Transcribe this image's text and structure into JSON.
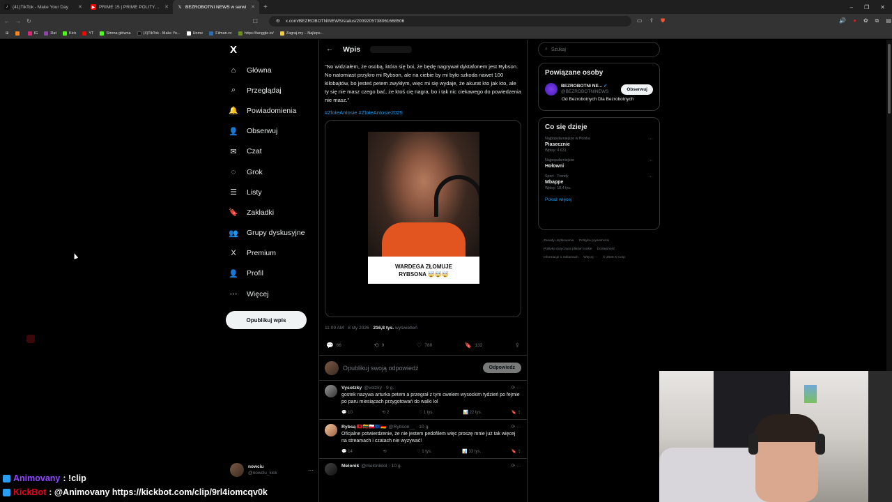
{
  "browser": {
    "tabs": [
      {
        "title": "(41)TikTok - Make Your Day",
        "icon_color": "#111111",
        "icon": "tiktok-icon",
        "active": false
      },
      {
        "title": "PRIME 15 | PRIME POLITYK SHOW -",
        "icon_color": "#ff0000",
        "icon": "youtube-icon",
        "active": false
      },
      {
        "title": "BEZROBOTNI NEWS w serwi",
        "icon_color": "#ffffff",
        "icon": "x-icon",
        "active": true
      }
    ],
    "new_tab": "+",
    "url": "x.com/BEZROBOTNINEWS/status/2009205738061668506",
    "bookmarks": [
      {
        "label": "",
        "color": "#f58220"
      },
      {
        "label": "IG",
        "color": "#d62976"
      },
      {
        "label": "Rat",
        "color": "#8e44ad"
      },
      {
        "label": "Kick",
        "color": "#53fc18"
      },
      {
        "label": "YT",
        "color": "#ff0000"
      },
      {
        "label": "Strona główna",
        "color": "#53fc18"
      },
      {
        "label": "(4)TikTok - Make Yo...",
        "color": "#111111"
      },
      {
        "label": "Home",
        "color": "#ffffff"
      },
      {
        "label": "Filman.cc",
        "color": "#2b6cb0"
      },
      {
        "label": "https://tanggle.io/",
        "color": "#6b8e23"
      },
      {
        "label": "Zagraj.my – Najleps...",
        "color": "#f2c94c"
      }
    ]
  },
  "nav": {
    "logo": "X",
    "items": [
      {
        "label": "Główna",
        "icon": "⌂",
        "name": "home"
      },
      {
        "label": "Przeglądaj",
        "icon": "⌕",
        "name": "explore"
      },
      {
        "label": "Powiadomienia",
        "icon": "🔔",
        "name": "notifications"
      },
      {
        "label": "Obserwuj",
        "icon": "👤",
        "name": "follow"
      },
      {
        "label": "Czat",
        "icon": "✉",
        "name": "chat"
      },
      {
        "label": "Grok",
        "icon": "◌",
        "name": "grok"
      },
      {
        "label": "Listy",
        "icon": "☰",
        "name": "lists"
      },
      {
        "label": "Zakładki",
        "icon": "🔖",
        "name": "bookmarks"
      },
      {
        "label": "Grupy dyskusyjne",
        "icon": "👥",
        "name": "communities"
      },
      {
        "label": "Premium",
        "icon": "X",
        "name": "premium"
      },
      {
        "label": "Profil",
        "icon": "👤",
        "name": "profile"
      },
      {
        "label": "Więcej",
        "icon": "⋯",
        "name": "more"
      }
    ],
    "post_button": "Opublikuj wpis",
    "account": {
      "name": "nowciu",
      "handle": "@nowclu_kick",
      "dots": "···"
    }
  },
  "post": {
    "header": "Wpis",
    "text": "\"No widziałem, że osobą, która się boi, że będę nagrywał dyktafonem jest Rybson. No natomiast przykro mi Rybson, ale na ciebie by mi było szkoda nawet 100 kilobajtów, bo jesteś petem zwykłym, więc mi się wydaje, że akurat kto jak kto, ale ty się nie masz czego bać, że ktoś cię nagra, bo i tak nic ciekawego do powiedzenia nie masz.\"",
    "hashtags": "#ZloteAntosie #ZloteAntosie2025",
    "media_caption_1": "WARDEGA ZŁOMUJE",
    "media_caption_2": "RYBSONA 🤯🤯🤯",
    "time": "11:09 AM · 8 sty 2026 · ",
    "views_num": "216,8 tys.",
    "views_label": " wyświetleń",
    "stats": {
      "replies": "66",
      "reposts": "9",
      "likes": "780",
      "bookmarks": "132"
    },
    "reply_placeholder": "Opublikuj swoją odpowiedź",
    "reply_button": "Odpowiedz"
  },
  "replies": [
    {
      "name": "Vysotzky",
      "handle": "@vstzky · 9 g.",
      "text": "gostek nazywa arturka petem a przegrał z tym cwelem wysockim tydzień po fejmie po paru miesiącach przygotowań do walki lol",
      "stats": {
        "replies": "10",
        "reposts": "2",
        "likes": "1 tys.",
        "views": "22 tys."
      }
    },
    {
      "name": "Rybsą 🇦🇱🇱🇹🇵🇱🇪🇺🇩🇪",
      "handle": "@Rybson__ · 10 g.",
      "text": "Oficjalne potwierdzenie, że nie jestem pedofilem więc proszę mnie już tak więcej na streamach i czatach nie wyzywać!",
      "stats": {
        "replies": "14",
        "reposts": "",
        "likes": "1 tys.",
        "views": "33 tys."
      }
    },
    {
      "name": "Melonik",
      "handle": "@meloniklol · 10 g.",
      "text": "",
      "stats": {
        "replies": "",
        "reposts": "",
        "likes": "",
        "views": ""
      }
    }
  ],
  "sidebar": {
    "search_placeholder": "Szukaj",
    "related_title": "Powiązane osoby",
    "related": {
      "name": "BEZROBOTNI NE...",
      "handle": "@BEZROBOTNINEWS",
      "bio": "Od Bezrobotnych Dla Bezrobotnych",
      "follow": "Obserwuj"
    },
    "trending_title": "Co się dzieje",
    "trends": [
      {
        "context": "Najpopularniejsze w Polska",
        "name": "Piasecznie",
        "posts": "Wpisy: 4 631"
      },
      {
        "context": "Najpopularniejsze",
        "name": "Hołowni",
        "posts": ""
      },
      {
        "context": "Sport · Trendy",
        "name": "Mbappe",
        "posts": "Wpisy: 18,4 tys."
      }
    ],
    "show_more": "Pokaż więcej",
    "footer": [
      "Zasady użytkowania",
      "Polityka prywatności",
      "Polityka dotycząca plików cookie",
      "Dostępność",
      "Informacje o reklamach",
      "Więcej ···",
      "© 2026 X Corp."
    ]
  },
  "stream_chat": [
    {
      "user": "Animovany",
      "msg": ": !clip",
      "user_color": "#9147ff",
      "icon_color": "#2a9df4"
    },
    {
      "user": "KickBot",
      "msg": ": @Animovany https://kickbot.com/clip/9rl4iomcqv0k",
      "user_color": "#e8001c",
      "icon_color": "#2a9df4"
    }
  ]
}
